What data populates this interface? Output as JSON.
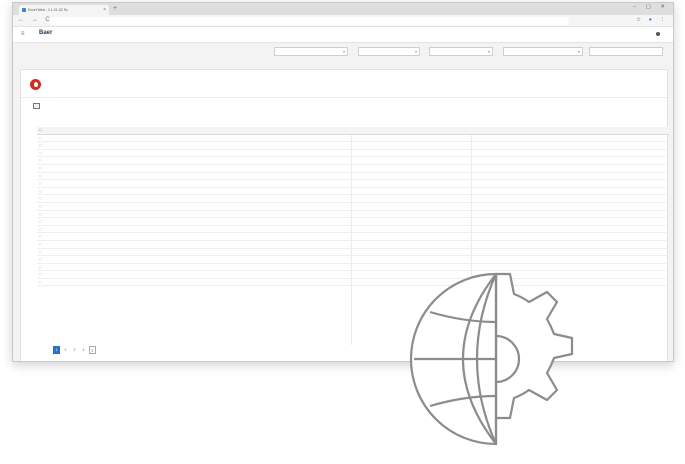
{
  "browser": {
    "tab_title": "Excel Web - 4 1-01-02 Sc",
    "url": "",
    "window_controls": "– ▢ ✕",
    "nav_glyphs": "← → C",
    "new_tab": "+",
    "tab_close": "×"
  },
  "app": {
    "logo": "Baer",
    "subtitle": "",
    "user": "",
    "menu_glyph": "≡"
  },
  "filters": [
    {
      "label": "",
      "chevron": "▾"
    },
    {
      "label": "",
      "chevron": "▾"
    },
    {
      "label": "",
      "chevron": "▾"
    },
    {
      "label": "",
      "chevron": "▾"
    }
  ],
  "filter_button": "",
  "card": {
    "title": "",
    "section_title": ""
  },
  "grid": {
    "header_glyph": "☐",
    "row_glyph": "▢"
  },
  "pager": {
    "pages": [
      "1",
      "2",
      "3",
      "4",
      "5"
    ]
  },
  "colors": {
    "accent": "#2a70c9",
    "brand": "#d42d1f",
    "type_badge": "#e08a00"
  },
  "icons": [
    "globe-gear-icon",
    "brand-logo-icon",
    "user-icon",
    "menu-icon"
  ]
}
